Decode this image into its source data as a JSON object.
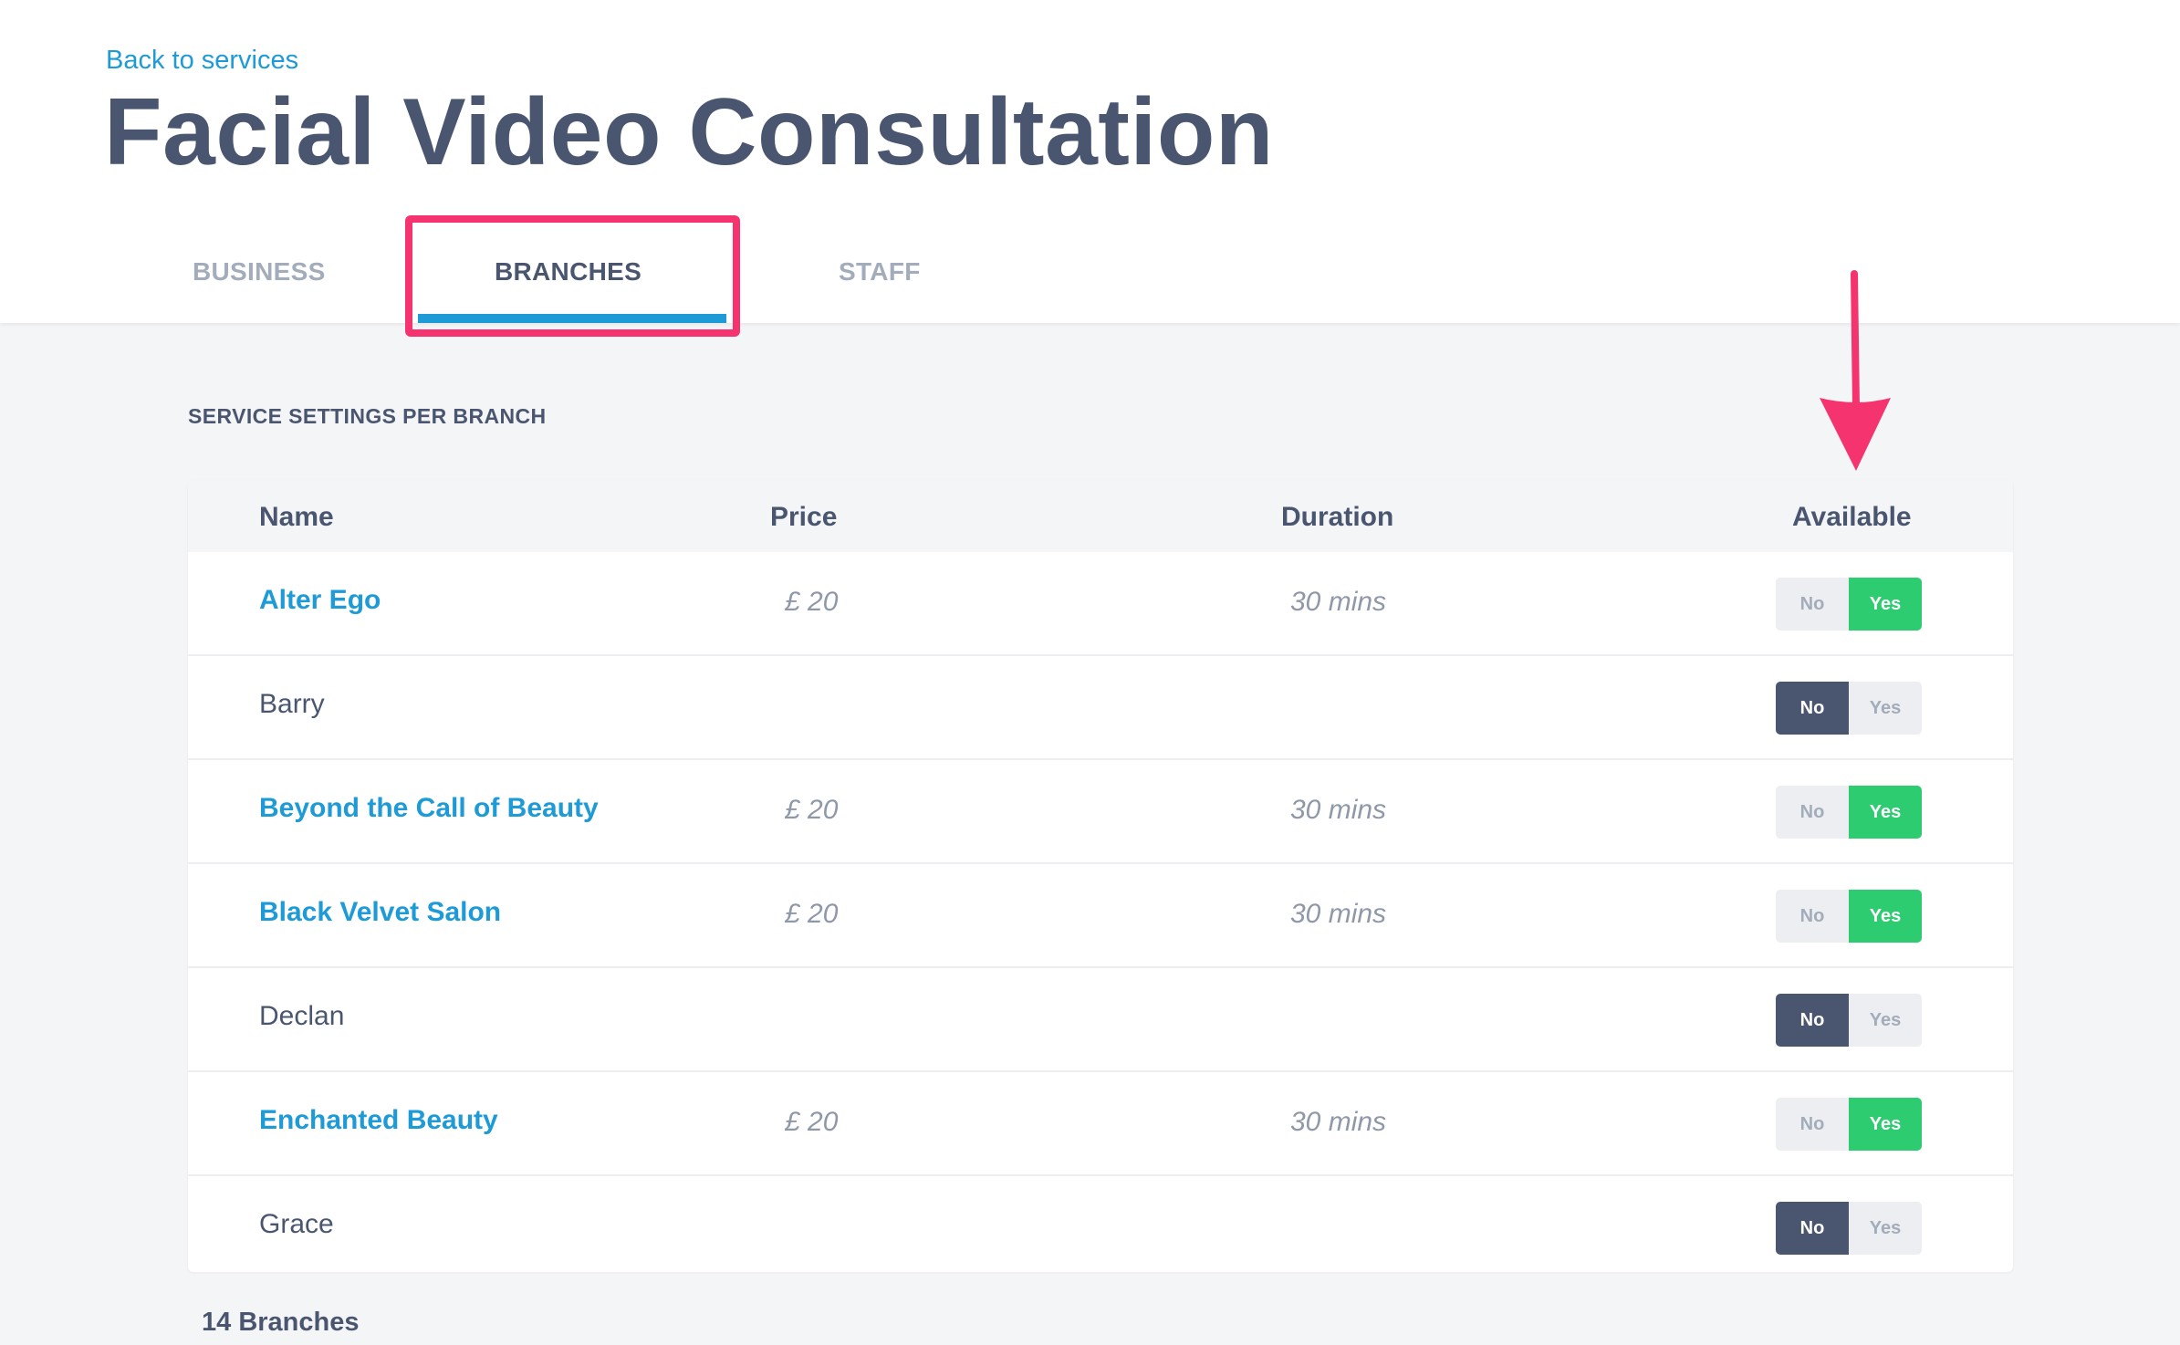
{
  "header": {
    "back_link": "Back to services",
    "title": "Facial Video Consultation"
  },
  "tabs": {
    "business": "BUSINESS",
    "branches": "BRANCHES",
    "staff": "STAFF",
    "active": "BRANCHES"
  },
  "section": {
    "title": "SERVICE SETTINGS PER BRANCH"
  },
  "table": {
    "columns": {
      "name": "Name",
      "price": "Price",
      "duration": "Duration",
      "available": "Available"
    },
    "rows": [
      {
        "name": "Alter Ego",
        "price": "£ 20",
        "duration": "30 mins",
        "available": "Yes"
      },
      {
        "name": "Barry",
        "price": "",
        "duration": "",
        "available": "No"
      },
      {
        "name": "Beyond the Call of Beauty",
        "price": "£ 20",
        "duration": "30 mins",
        "available": "Yes"
      },
      {
        "name": "Black Velvet Salon",
        "price": "£ 20",
        "duration": "30 mins",
        "available": "Yes"
      },
      {
        "name": "Declan",
        "price": "",
        "duration": "",
        "available": "No"
      },
      {
        "name": "Enchanted Beauty",
        "price": "£ 20",
        "duration": "30 mins",
        "available": "Yes"
      },
      {
        "name": "Grace",
        "price": "",
        "duration": "",
        "available": "No"
      }
    ],
    "toggle_labels": {
      "no": "No",
      "yes": "Yes"
    }
  },
  "footer": {
    "count_label": "14 Branches"
  },
  "colors": {
    "accent": "#1e9bd7",
    "heading": "#4a5670",
    "toggle_yes": "#2ecc71",
    "toggle_no": "#4a5670",
    "annotation": "#f5336f"
  }
}
